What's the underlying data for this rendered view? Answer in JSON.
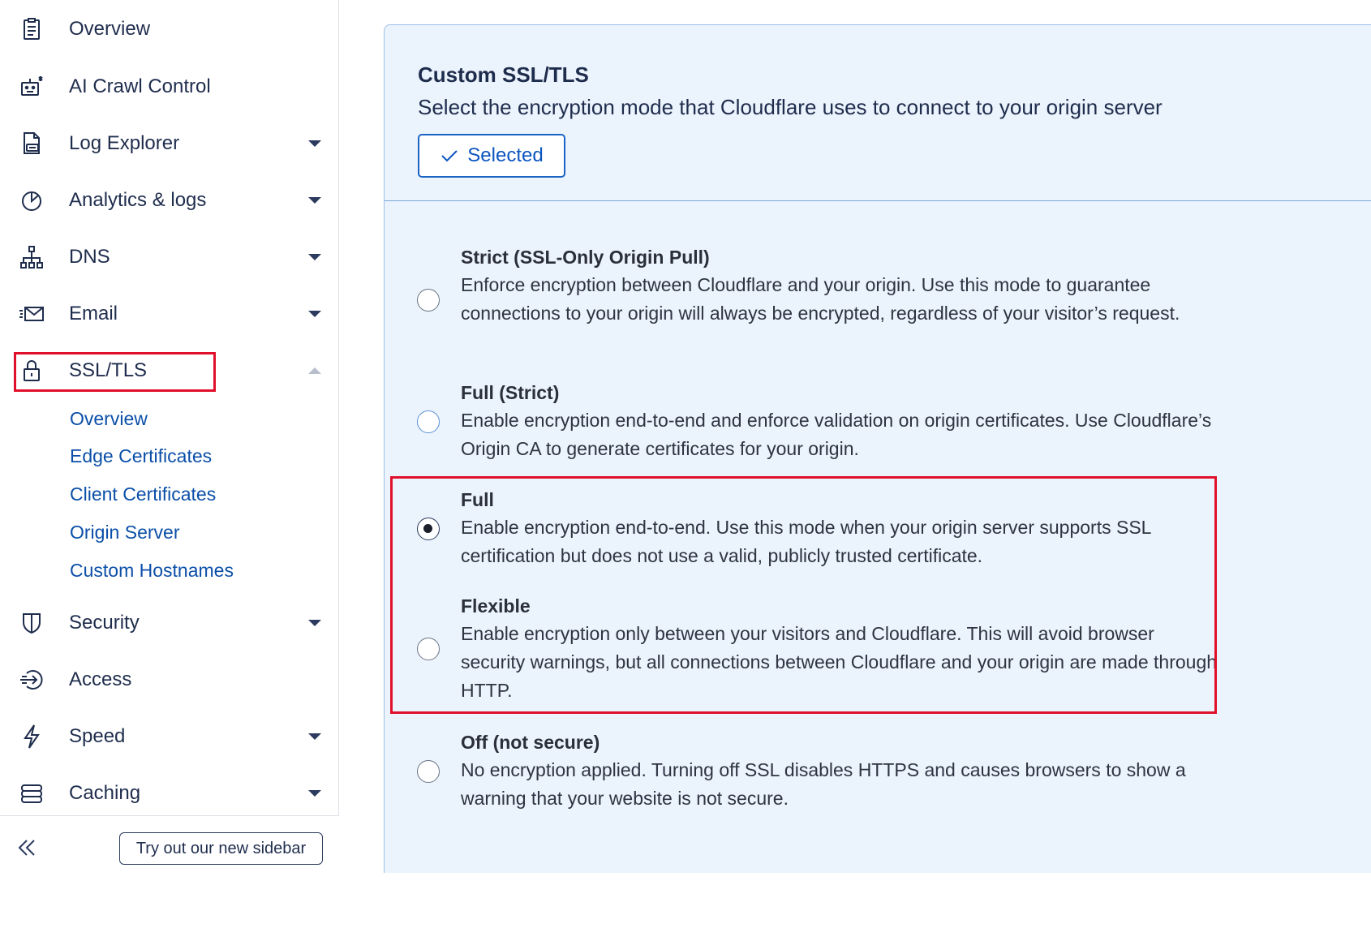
{
  "sidebar": {
    "items": [
      {
        "label": "Overview",
        "icon": "clipboard-icon"
      },
      {
        "label": "AI Crawl Control",
        "icon": "robot-icon"
      },
      {
        "label": "Log Explorer",
        "icon": "log-document-icon"
      },
      {
        "label": "Analytics & logs",
        "icon": "pie-chart-icon"
      },
      {
        "label": "DNS",
        "icon": "network-tree-icon"
      },
      {
        "label": "Email",
        "icon": "envelope-icon"
      },
      {
        "label": "SSL/TLS",
        "icon": "lock-icon"
      },
      {
        "label": "Security",
        "icon": "shield-icon"
      },
      {
        "label": "Access",
        "icon": "access-icon"
      },
      {
        "label": "Speed",
        "icon": "lightning-icon"
      },
      {
        "label": "Caching",
        "icon": "storage-icon"
      }
    ],
    "ssl_sub_items": [
      "Overview",
      "Edge Certificates",
      "Client Certificates",
      "Origin Server",
      "Custom Hostnames"
    ],
    "footer": {
      "try_label": "Try out our new sidebar"
    }
  },
  "card": {
    "title": "Custom SSL/TLS",
    "subtitle": "Select the encryption mode that Cloudflare uses to connect to your origin server",
    "selected_label": "Selected",
    "options": [
      {
        "title": "Strict (SSL-Only Origin Pull)",
        "desc": "Enforce encryption between Cloudflare and your origin. Use this mode to guarantee connections to your origin will always be encrypted, regardless of your visitor’s request.",
        "checked": false
      },
      {
        "title": "Full (Strict)",
        "desc": "Enable encryption end-to-end and enforce validation on origin certificates. Use Cloudflare’s Origin CA to generate certificates for your origin.",
        "checked": false
      },
      {
        "title": "Full",
        "desc": "Enable encryption end-to-end. Use this mode when your origin server supports SSL certification but does not use a valid, publicly trusted certificate.",
        "checked": true
      },
      {
        "title": "Flexible",
        "desc": "Enable encryption only between your visitors and Cloudflare. This will avoid browser security warnings, but all connections between Cloudflare and your origin are made through HTTP.",
        "checked": false
      },
      {
        "title": "Off (not secure)",
        "desc": "No encryption applied. Turning off SSL disables HTTPS and causes browsers to show a warning that your website is not secure.",
        "checked": false
      }
    ]
  },
  "colors": {
    "accent": "#0b55c0",
    "highlight": "#e0102a",
    "card_bg": "#ebf3fc"
  }
}
